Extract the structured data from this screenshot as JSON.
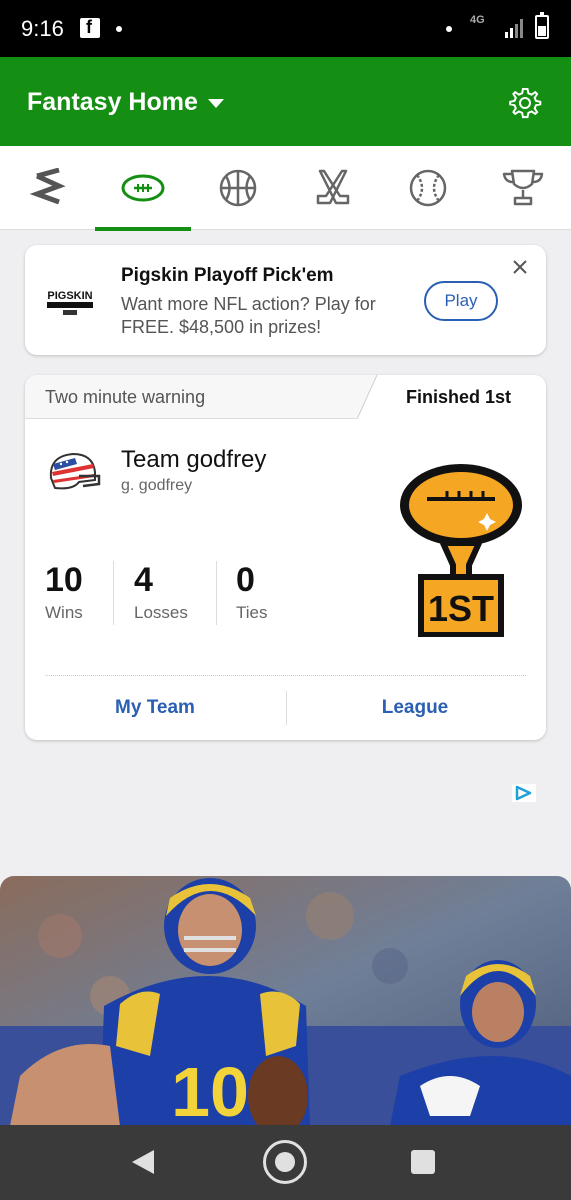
{
  "status_bar": {
    "time": "9:16",
    "network": "4G"
  },
  "header": {
    "title": "Fantasy Home"
  },
  "sports_tabs": [
    {
      "name": "all-sports",
      "active": false
    },
    {
      "name": "football",
      "active": true
    },
    {
      "name": "basketball",
      "active": false
    },
    {
      "name": "hockey",
      "active": false
    },
    {
      "name": "baseball",
      "active": false
    },
    {
      "name": "trophy",
      "active": false
    }
  ],
  "promo": {
    "logo_text": "PIGSKIN",
    "title": "Pigskin Playoff Pick'em",
    "description": "Want more NFL action? Play for FREE. $48,500 in prizes!",
    "button_label": "Play"
  },
  "team_card": {
    "header_label": "Two minute warning",
    "finish_label": "Finished 1st",
    "team_name": "Team godfrey",
    "owner": "g. godfrey",
    "stats": [
      {
        "value": "10",
        "label": "Wins"
      },
      {
        "value": "4",
        "label": "Losses"
      },
      {
        "value": "0",
        "label": "Ties"
      }
    ],
    "trophy_text": "1ST",
    "links": {
      "my_team": "My Team",
      "league": "League"
    }
  },
  "colors": {
    "brand_green": "#148e13",
    "link_blue": "#2a5fb3",
    "trophy_gold": "#f5a623"
  }
}
